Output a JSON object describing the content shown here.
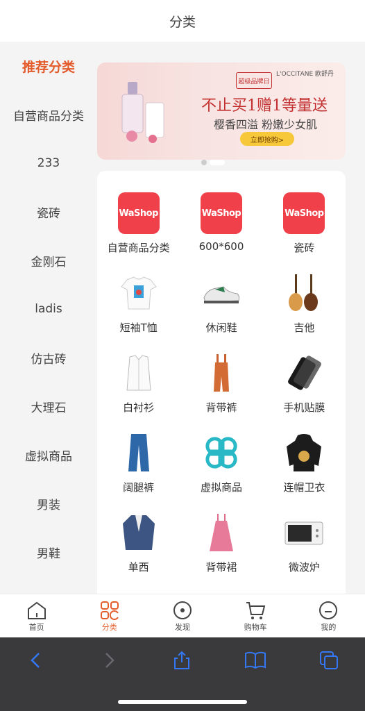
{
  "header": {
    "title": "分类"
  },
  "sidebar": {
    "items": [
      {
        "label": "推荐分类",
        "active": true
      },
      {
        "label": "自营商品分类"
      },
      {
        "label": "233"
      },
      {
        "label": "瓷砖"
      },
      {
        "label": "金刚石"
      },
      {
        "label": "ladis"
      },
      {
        "label": "仿古砖"
      },
      {
        "label": "大理石"
      },
      {
        "label": "虚拟商品"
      },
      {
        "label": "男装"
      },
      {
        "label": "男鞋"
      }
    ]
  },
  "banner": {
    "brand_left": "超级品牌日",
    "brand_right": "L'OCCITANE 欧舒丹",
    "tagline": "不止买1赠1等量送",
    "subline": "樱香四溢 粉嫩少女肌",
    "cta": "立即抢购>"
  },
  "categories": [
    {
      "label": "自营商品分类",
      "icon": "washop-logo",
      "logo_text": "WaShop"
    },
    {
      "label": "600*600",
      "icon": "washop-logo",
      "logo_text": "WaShop"
    },
    {
      "label": "瓷砖",
      "icon": "washop-logo",
      "logo_text": "WaShop"
    },
    {
      "label": "短袖T恤",
      "icon": "tshirt-icon"
    },
    {
      "label": "休闲鞋",
      "icon": "sneaker-icon"
    },
    {
      "label": "吉他",
      "icon": "guitar-icon"
    },
    {
      "label": "白衬衫",
      "icon": "shirt-icon"
    },
    {
      "label": "背带裤",
      "icon": "overalls-icon"
    },
    {
      "label": "手机贴膜",
      "icon": "screen-protector-icon"
    },
    {
      "label": "阔腿裤",
      "icon": "pants-icon"
    },
    {
      "label": "虚拟商品",
      "icon": "clover-icon"
    },
    {
      "label": "连帽卫衣",
      "icon": "hoodie-icon"
    },
    {
      "label": "单西",
      "icon": "blazer-icon"
    },
    {
      "label": "背带裙",
      "icon": "dress-icon"
    },
    {
      "label": "微波炉",
      "icon": "microwave-icon"
    }
  ],
  "tabbar": {
    "tabs": [
      {
        "label": "首页",
        "icon": "home-icon"
      },
      {
        "label": "分类",
        "icon": "category-icon",
        "active": true
      },
      {
        "label": "发现",
        "icon": "discover-icon"
      },
      {
        "label": "购物车",
        "icon": "cart-icon"
      },
      {
        "label": "我的",
        "icon": "profile-icon"
      }
    ]
  },
  "colors": {
    "accent": "#e35d2c",
    "washop": "#f0404a",
    "browser_bar": "#3a3a3c",
    "browser_icon": "#3478f6"
  }
}
